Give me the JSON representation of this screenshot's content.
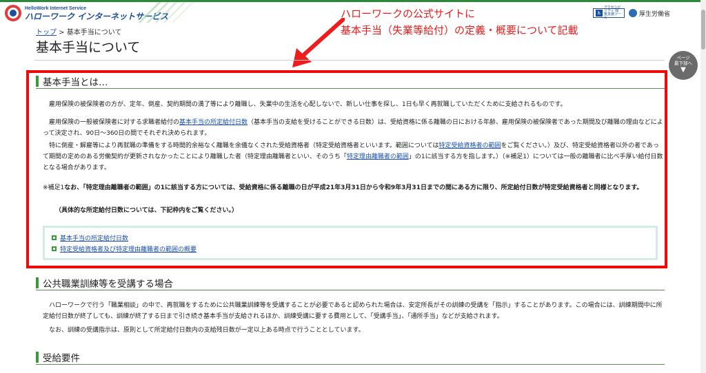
{
  "header": {
    "logo_en": "HelloWork Internet Service",
    "logo_jp": "ハローワーク インターネットサービス",
    "accessibility_label": "アクセシビリティ 閲覧支援ツール",
    "ministry": "厚生労働省"
  },
  "annotation": {
    "line1": "ハローワークの公式サイトに",
    "line2": "基本手当（失業等給付）の定義・概要について記載"
  },
  "breadcrumb": {
    "top_link": "トップ",
    "separator": " > ",
    "current": "基本手当について"
  },
  "page_title": "基本手当について",
  "page_bottom_button": {
    "line1": "ページ",
    "line2": "最下部へ",
    "chevron": "▼"
  },
  "section1": {
    "heading": "基本手当とは…",
    "p1": "雇用保険の被保険者の方が、定年、倒産、契約期間の満了等により離職し、失業中の生活を心配しないで、新しい仕事を探し、1日も早く再就職していただくために支給されるものです。",
    "p2_before": "雇用保険の一般被保険者に対する求職者給付の",
    "p2_link": "基本手当の所定給付日数",
    "p2_after": "（基本手当の支給を受けることができる日数）は、受給資格に係る離職の日における年齢、雇用保険の被保険者であった期間及び離職の理由などによって決定され、90日～360日の間でそれぞれ決められます。",
    "p3_a": "特に倒産・解雇等により再就職の準備をする時間的余裕なく離職を余儀なくされた受給資格者（特定受給資格者といいます。範囲については",
    "p3_link1": "特定受給資格者の範囲",
    "p3_b": "をご覧ください。）及び、特定受給資格者以外の者であって期間の定めのある労働契約が更新されなかったことにより離職した者（特定理由離職者といい、そのうち「",
    "p3_link2": "特定理由離職者の範囲",
    "p3_c": "」の1に該当する方を指します。）（※補足1）については一般の離職者に比べ手厚い給付日数となる場合があります。",
    "note_prefix": "※補足1",
    "note_bold": "なお、「特定理由離職者の範囲」の1に該当する方については、受給資格に係る離職の日が平成21年3月31日から令和9年3月31日までの間にある方に限り、所定給付日数が特定受給資格者と同様となります。",
    "note2": "（具体的な所定給付日数については、下記枠内をご覧ください。）",
    "links": [
      "基本手当の所定給付日数",
      "特定受給資格者及び特定理由離職者の範囲の概要"
    ]
  },
  "section2": {
    "heading": "公共職業訓練等を受講する場合",
    "p1": "ハローワークで行う「職業相談」の中で、再就職をするために公共職業訓練等を受講することが必要であると認められた場合は、安定所長がその訓練の受講を「指示」することがあります。この場合には、訓練期間中に所定給付日数が終了しても、訓練が終了する日まで引き続き基本手当が支給されるほか、訓練受講に要する費用として、「受講手当」、「通所手当」などが支給されます。",
    "p2": "なお、訓練の受講指示は、原則として所定給付日数内の支給残日数が一定以上ある時点で行うこととしています。"
  },
  "section3": {
    "heading": "受給要件"
  },
  "colors": {
    "accent_green": "#3a9a3a",
    "annotation_red": "#ee1c1c",
    "link_blue": "#1a4fb0"
  }
}
